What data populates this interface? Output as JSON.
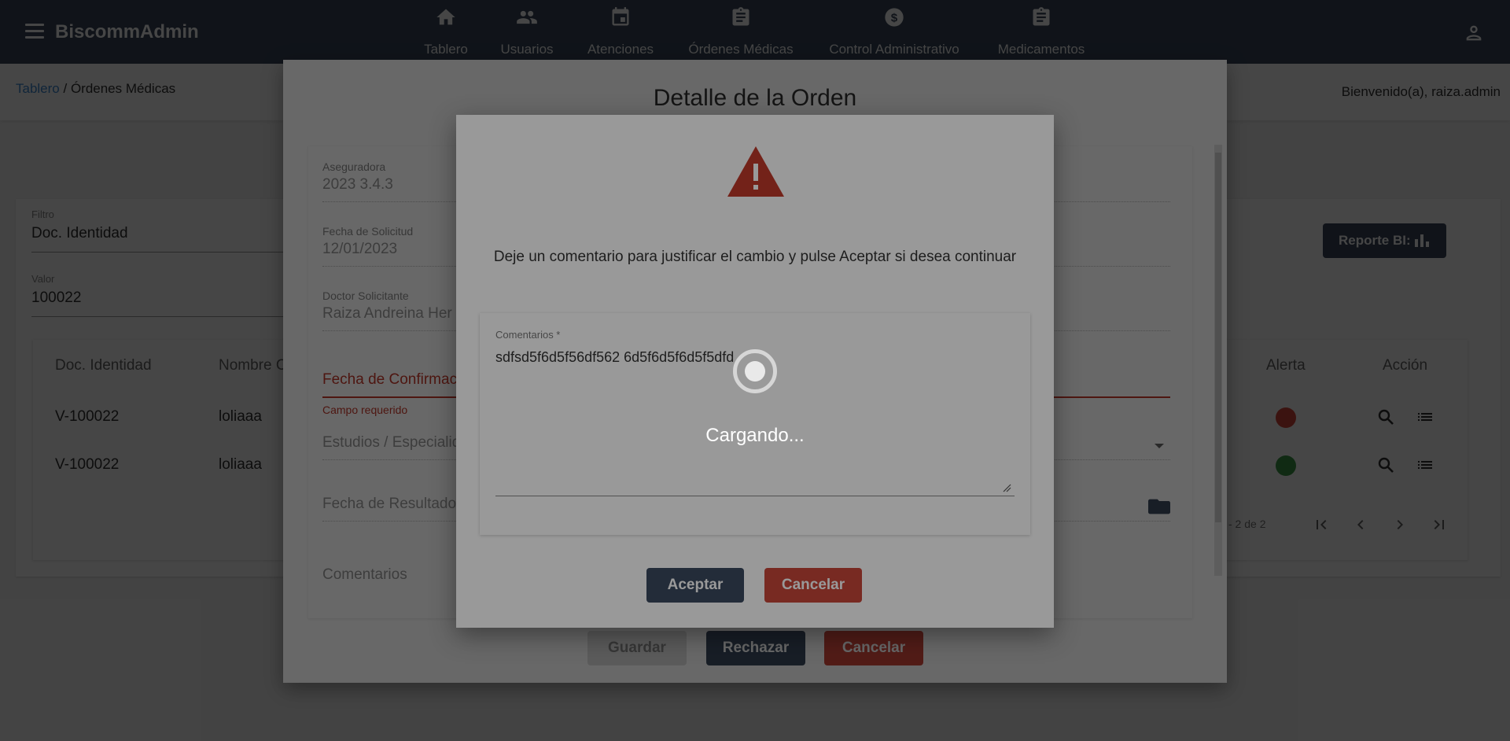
{
  "app": {
    "brand": "BiscommAdmin"
  },
  "nav": [
    {
      "label": "Tablero",
      "icon": "home-icon"
    },
    {
      "label": "Usuarios",
      "icon": "users-icon"
    },
    {
      "label": "Atenciones",
      "icon": "calendar-icon"
    },
    {
      "label": "Órdenes Médicas",
      "icon": "clipboard-icon"
    },
    {
      "label": "Control Administrativo",
      "icon": "dollar-icon"
    },
    {
      "label": "Medicamentos",
      "icon": "clipboard-icon"
    }
  ],
  "breadcrumb": {
    "root": "Tablero",
    "sep": " / ",
    "current": "Órdenes Médicas"
  },
  "welcome": "Bienvenido(a), raiza.admin",
  "filters": {
    "filter_label": "Filtro",
    "filter_value": "Doc. Identidad",
    "value_label": "Valor",
    "value_value": "100022"
  },
  "report_button": "Reporte BI:",
  "table": {
    "headers": [
      "Doc. Identidad",
      "Nombre C",
      "Alerta",
      "Acción"
    ],
    "rows": [
      {
        "doc": "V-100022",
        "name": "loliaaa",
        "alert": "#d94b3b"
      },
      {
        "doc": "V-100022",
        "name": "loliaaa",
        "alert": "#3c9a47"
      }
    ],
    "pager": "- 2 de 2"
  },
  "order_dialog": {
    "title": "Detalle de la Orden",
    "fields": [
      {
        "label": "Aseguradora",
        "value": "2023 3.4.3"
      },
      {
        "label": "Fecha de Solicitud",
        "value": "12/01/2023"
      },
      {
        "label": "Doctor Solicitante",
        "value": "Raiza Andreina Her"
      },
      {
        "label": "",
        "value": "Fecha de Confirmaci"
      },
      {
        "label": "",
        "value": "Estudios / Especialid"
      },
      {
        "label": "",
        "value": "Fecha de Resultados"
      },
      {
        "label": "",
        "value": "Comentarios"
      }
    ],
    "error_hint": "Campo requerido",
    "buttons": {
      "save": "Guardar",
      "reject": "Rechazar",
      "cancel": "Cancelar"
    }
  },
  "confirm_dialog": {
    "message": "Deje un comentario para justificar el cambio y pulse Aceptar si desea continuar",
    "comment_label": "Comentarios *",
    "comment_value": "sdfsd5f6d5f56df562 6d5f6d5f6d5f5dfd",
    "accept": "Aceptar",
    "cancel": "Cancelar"
  },
  "loading": {
    "text": "Cargando..."
  },
  "colors": {
    "topbar": "#3b4a5f",
    "accept": "#3b4a5f",
    "cancel": "#c9463a",
    "warning": "#c0392b",
    "link": "#3f8bd6"
  }
}
